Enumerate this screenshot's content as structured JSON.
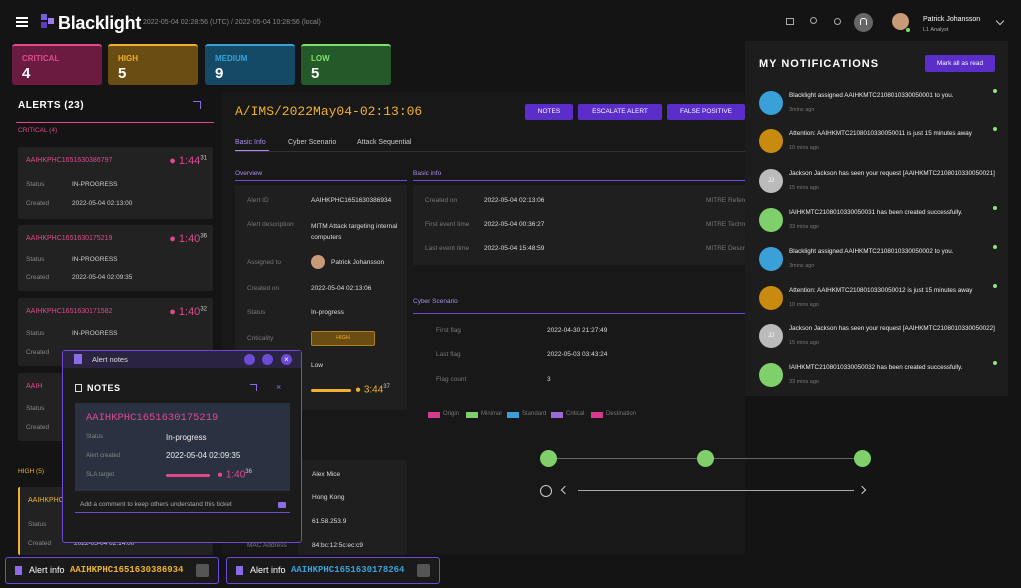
{
  "header": {
    "brand": "Blacklight",
    "times": "2022-05-04 02:28:56 (UTC) / 2022-05-04 10:28:56 (local)",
    "user_name": "Patrick Johansson",
    "user_role": "L1 Analyst"
  },
  "severity": [
    {
      "label": "CRITICAL",
      "count": "4",
      "color": "#e04a8a",
      "bg": "#6b1b40"
    },
    {
      "label": "HIGH",
      "count": "5",
      "color": "#f0b030",
      "bg": "#6a4d12"
    },
    {
      "label": "MEDIUM",
      "count": "9",
      "color": "#3aa0d8",
      "bg": "#144a66"
    },
    {
      "label": "LOW",
      "count": "5",
      "color": "#7fe06b",
      "bg": "#245a2a"
    }
  ],
  "alerts": {
    "title": "ALERTS (23)",
    "critical_header": "CRITICAL (4)",
    "high_header": "HIGH (5)",
    "status_label": "Status",
    "created_label": "Created",
    "cards": [
      {
        "id": "AAIHKPHC1651630386797",
        "timer": "1:44",
        "timer_sec": "31",
        "status": "IN-PROGRESS",
        "created": "2022-05-04 02:13:00"
      },
      {
        "id": "AAIHKPHC1651630175219",
        "timer": "1:40",
        "timer_sec": "36",
        "status": "IN-PROGRESS",
        "created": "2022-05-04 02:09:35"
      },
      {
        "id": "AAIHKPHC1651630171582",
        "timer": "1:40",
        "timer_sec": "32",
        "status": "IN-PROGRESS",
        "created": ""
      }
    ],
    "partial_id_1": "AAIH",
    "partial_id_2": "AAIHKPHC",
    "partial_created": "2022-05-04 02:14:00"
  },
  "detail": {
    "path": "A/IMS/2022May04-02:13:06",
    "btn_notes": "NOTES",
    "btn_escalate": "ESCALATE ALERT",
    "btn_false_positive": "FALSE POSITIVE",
    "tabs": [
      "Basic Info",
      "Cyber Scenario",
      "Attack Sequential"
    ],
    "overview_label": "Overview",
    "basic_info_label": "Basic info",
    "overview": [
      {
        "k": "Alert ID",
        "v": "AAIHKPHC1651630386934"
      },
      {
        "k": "Alert description",
        "v": "MITM Attack targeting internal computers"
      },
      {
        "k": "Assigned to",
        "v": "Patrick Johansson"
      },
      {
        "k": "Created on",
        "v": "2022-05-04 02:13:06"
      },
      {
        "k": "Status",
        "v": "In-progress"
      },
      {
        "k": "Criticality",
        "v": "HIGH"
      },
      {
        "k": "",
        "v": "Low"
      }
    ],
    "sla_time": "3:44",
    "sla_sec": "37",
    "basic": [
      {
        "k": "Created on",
        "v": "2022-05-04 02:13:06"
      },
      {
        "k": "First event time",
        "v": "2022-05-04 00:36:27"
      },
      {
        "k": "Last event time",
        "v": "2022-05-04 15:48:59"
      }
    ],
    "mitre": [
      "MITRE Refere",
      "MITRE Techn",
      "MITRE Descri"
    ],
    "cyber_label": "Cyber Scenario",
    "cyber": [
      {
        "k": "First flag",
        "v": "2022-04-30 21:27:49"
      },
      {
        "k": "Last flag",
        "v": "2022-05-03 03:43:24"
      },
      {
        "k": "Flag count",
        "v": "3"
      }
    ],
    "legend": [
      {
        "name": "Origin",
        "color": "#d63a8a"
      },
      {
        "name": "Minimal",
        "color": "#7fd06b"
      },
      {
        "name": "Standard",
        "color": "#3aa0d8"
      },
      {
        "name": "Critical",
        "color": "#9b6bd8"
      },
      {
        "name": "Destination",
        "color": "#d63a8a"
      }
    ],
    "lower": [
      {
        "k": "",
        "v": "Alex Mice"
      },
      {
        "k": "",
        "v": "Hong Kong"
      },
      {
        "k": "",
        "v": "61.58.253.9"
      },
      {
        "k": "MAC Address",
        "v": "84:bc:12:5c:ec:c9"
      }
    ]
  },
  "notes_window": {
    "title": "Alert notes",
    "heading": "NOTES",
    "alert_id": "AAIHKPHC1651630175219",
    "status_label": "Status",
    "status": "In-progress",
    "created_label": "Alert created",
    "created": "2022-05-04 02:09:35",
    "sla_label": "SLA target",
    "timer": "1:40",
    "timer_sec": "36",
    "comment_placeholder": "Add a comment to keep others understand this ticket"
  },
  "notifications": {
    "title": "MY NOTIFICATIONS",
    "mark_all": "Mark all as read",
    "items": [
      {
        "text": "Blacklight assigned AAIHKMTC2108010330050001 to you.",
        "time": "3mins ago",
        "kind": "blue",
        "initials": ""
      },
      {
        "text": "Attention: AAIHKMTC2108010330050011 is just 15 minutes away",
        "time": "10 mins ago",
        "kind": "orange",
        "initials": ""
      },
      {
        "text": "Jackson Jackson has seen your request [AAIHKMTC2108010330050021]",
        "time": "15 mins ago",
        "kind": "grey",
        "initials": "JJ"
      },
      {
        "text": "IAIHKMTC2108010330050031 has been created successfully.",
        "time": "33 mins ago",
        "kind": "green",
        "initials": ""
      },
      {
        "text": "Blacklight assigned AAIHKMTC2108010330050002 to you.",
        "time": "3mins ago",
        "kind": "blue",
        "initials": ""
      },
      {
        "text": "Attention: AAIHKMTC2108010330050012 is just 15 minutes away",
        "time": "10 mins ago",
        "kind": "orange",
        "initials": ""
      },
      {
        "text": "Jackson Jackson has seen your request [AAIHKMTC2108010330050022]",
        "time": "15 mins ago",
        "kind": "grey",
        "initials": "JJ"
      },
      {
        "text": "IAIHKMTC2108010330050032 has been created successfully.",
        "time": "33 mins ago",
        "kind": "green",
        "initials": ""
      }
    ]
  },
  "footer": {
    "tab1_label": "Alert info",
    "tab1_id": "AAIHKPHC1651630386934",
    "tab2_label": "Alert info",
    "tab2_id": "AAIHKPHC1651630178264"
  }
}
